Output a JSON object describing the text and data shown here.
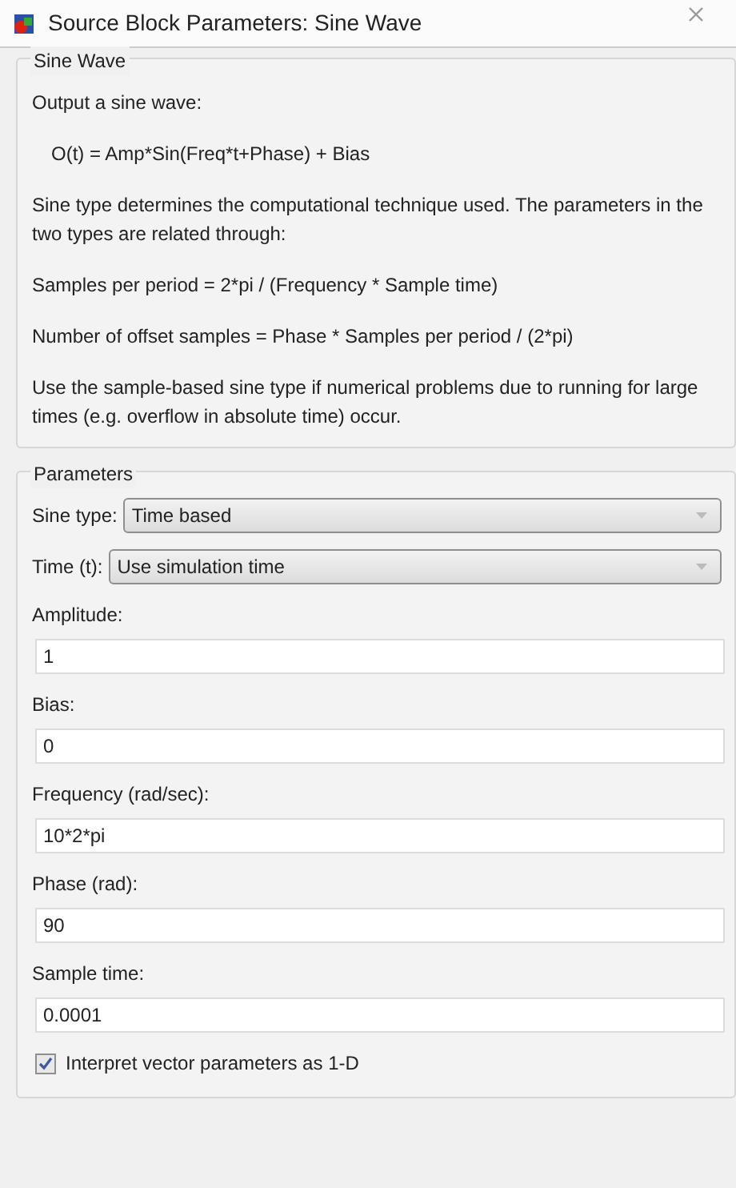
{
  "window": {
    "title": "Source Block Parameters: Sine Wave"
  },
  "description": {
    "title": "Sine Wave",
    "paragraphs": [
      "Output a sine wave:",
      "O(t) = Amp*Sin(Freq*t+Phase) + Bias",
      "Sine type determines the computational technique used. The parameters in the two types are related through:",
      "Samples per period = 2*pi / (Frequency * Sample time)",
      "Number of offset samples = Phase * Samples per period / (2*pi)",
      "Use the sample-based sine type if numerical problems due to running for large times (e.g. overflow in absolute time) occur."
    ]
  },
  "parameters": {
    "title": "Parameters",
    "fields": [
      {
        "kind": "dropdown",
        "label": "Sine type:",
        "value": "Time based"
      },
      {
        "kind": "dropdown",
        "label": "Time (t):",
        "value": "Use simulation time"
      },
      {
        "kind": "text",
        "label": "Amplitude:",
        "value": "1"
      },
      {
        "kind": "text",
        "label": "Bias:",
        "value": "0"
      },
      {
        "kind": "text",
        "label": "Frequency (rad/sec):",
        "value": "10*2*pi"
      },
      {
        "kind": "text",
        "label": "Phase (rad):",
        "value": "90"
      },
      {
        "kind": "text",
        "label": "Sample time:",
        "value": "0.0001"
      },
      {
        "kind": "checkbox",
        "label": "Interpret vector parameters as 1-D",
        "checked": true
      }
    ]
  }
}
